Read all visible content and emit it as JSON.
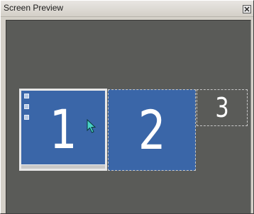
{
  "window": {
    "title": "Screen Preview",
    "close_icon": "close-icon"
  },
  "monitors": [
    {
      "number": "1",
      "selected": true,
      "shows_desktop": true
    },
    {
      "number": "2",
      "selected": false
    },
    {
      "number": "3",
      "selected": false
    }
  ],
  "colors": {
    "client_background": "#5a5b58",
    "monitor_fill": "#3a66a8",
    "cursor": "#4ad2c8"
  }
}
